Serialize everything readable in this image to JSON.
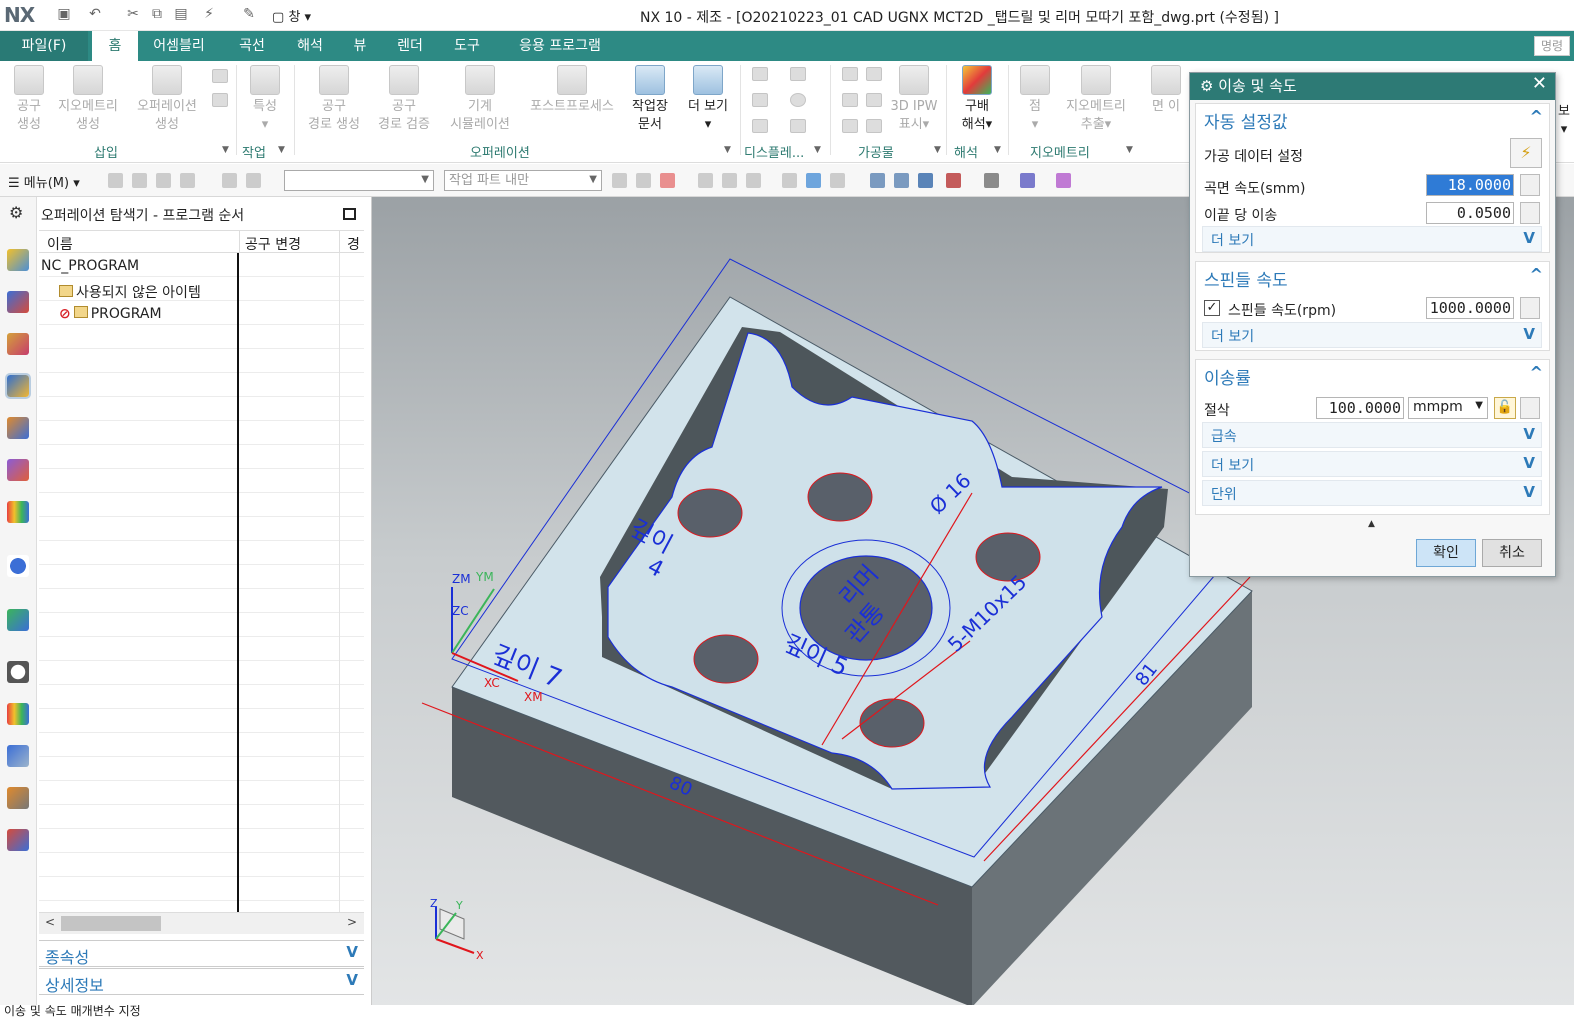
{
  "app": {
    "logo": "NX",
    "title": "NX 10 - 제조 - [O20210223_01 CAD UGNX MCT2D _탭드릴 및 리머 모따기 포함_dwg.prt (수정됨) ]",
    "window_menu": "창"
  },
  "ribbon_tabs": {
    "file": "파일(F)",
    "tabs": [
      "홈",
      "어셈블리",
      "곡선",
      "해석",
      "뷰",
      "렌더",
      "도구",
      "응용 프로그램"
    ],
    "command_search": "명령"
  },
  "ribbon": {
    "buttons": [
      {
        "l1": "공구",
        "l2": "생성"
      },
      {
        "l1": "지오메트리",
        "l2": "생성"
      },
      {
        "l1": "오퍼레이션",
        "l2": "생성"
      },
      {
        "l1": "특성",
        "l2": "▾"
      },
      {
        "l1": "공구",
        "l2": "경로 생성"
      },
      {
        "l1": "공구",
        "l2": "경로 검증"
      },
      {
        "l1": "기계",
        "l2": "시뮬레이션"
      },
      {
        "l1": "포스트프로세스",
        "l2": ""
      },
      {
        "l1": "작업장",
        "l2": "문서"
      },
      {
        "l1": "더 보기",
        "l2": "▾"
      },
      {
        "l1": "3D IPW",
        "l2": "표시▾"
      },
      {
        "l1": "구배",
        "l2": "해석▾"
      },
      {
        "l1": "점",
        "l2": "▾"
      },
      {
        "l1": "지오메트리",
        "l2": "추출▾"
      },
      {
        "l1": "면 이",
        "l2": ""
      },
      {
        "l1": "보",
        "l2": "▾"
      }
    ],
    "groups": [
      "삽입",
      "작업",
      "오퍼레이션",
      "디스플레...",
      "가공물",
      "해석",
      "지오메트리"
    ]
  },
  "toolbar": {
    "menu": "메뉴(M)",
    "filter_empty": "",
    "scope": "작업 파트 내만"
  },
  "navigator": {
    "title": "오퍼레이션 탐색기 - 프로그램 순서",
    "columns": [
      "이름",
      "공구 변경",
      "경"
    ],
    "rows": [
      "NC_PROGRAM",
      "사용되지 않은 아이템",
      "PROGRAM"
    ],
    "panels": [
      "종속성",
      "상세정보"
    ]
  },
  "dialog": {
    "title": "이송 및 속도",
    "sections": {
      "auto": {
        "title": "자동 설정값",
        "machining_data": "가공 데이터 설정",
        "surface_speed_label": "곡면 속도(smm)",
        "surface_speed": "18.0000",
        "feed_per_tooth_label": "이끝 당 이송",
        "feed_per_tooth": "0.0500",
        "more": "더 보기"
      },
      "spindle": {
        "title": "스핀들 속도",
        "spindle_label": "스핀들 속도(rpm)",
        "spindle_value": "1000.0000",
        "spindle_checked": true,
        "more": "더 보기"
      },
      "feed": {
        "title": "이송률",
        "cut_label": "절삭",
        "cut_value": "100.0000",
        "unit": "mmpm",
        "rapid": "급속",
        "more": "더 보기",
        "units": "단위"
      }
    },
    "ok": "확인",
    "cancel": "취소"
  },
  "model": {
    "labels": {
      "depth7": "깊이 7",
      "depth4a": "깊이",
      "depth4b": "4",
      "depth5": "깊이 5",
      "reamer_a": "리머",
      "reamer_b": "관통",
      "tap": "5-M10x15",
      "dia": "Ø 16",
      "dim80": "80",
      "dim81": "81"
    },
    "axes": {
      "zm": "ZM",
      "ym": "YM",
      "zc": "ZC",
      "xc": "XC",
      "xm": "XM",
      "z": "Z",
      "y": "Y",
      "x": "X"
    }
  },
  "status": "이송 및 속도 매개변수 지정",
  "colors": {
    "teal": "#2d8a84",
    "accent_blue": "#2d7ab8",
    "plate": "#d3e4ec",
    "wall": "#555c61",
    "dim_red": "#e0161c",
    "annot_blue": "#1a2fd6"
  }
}
